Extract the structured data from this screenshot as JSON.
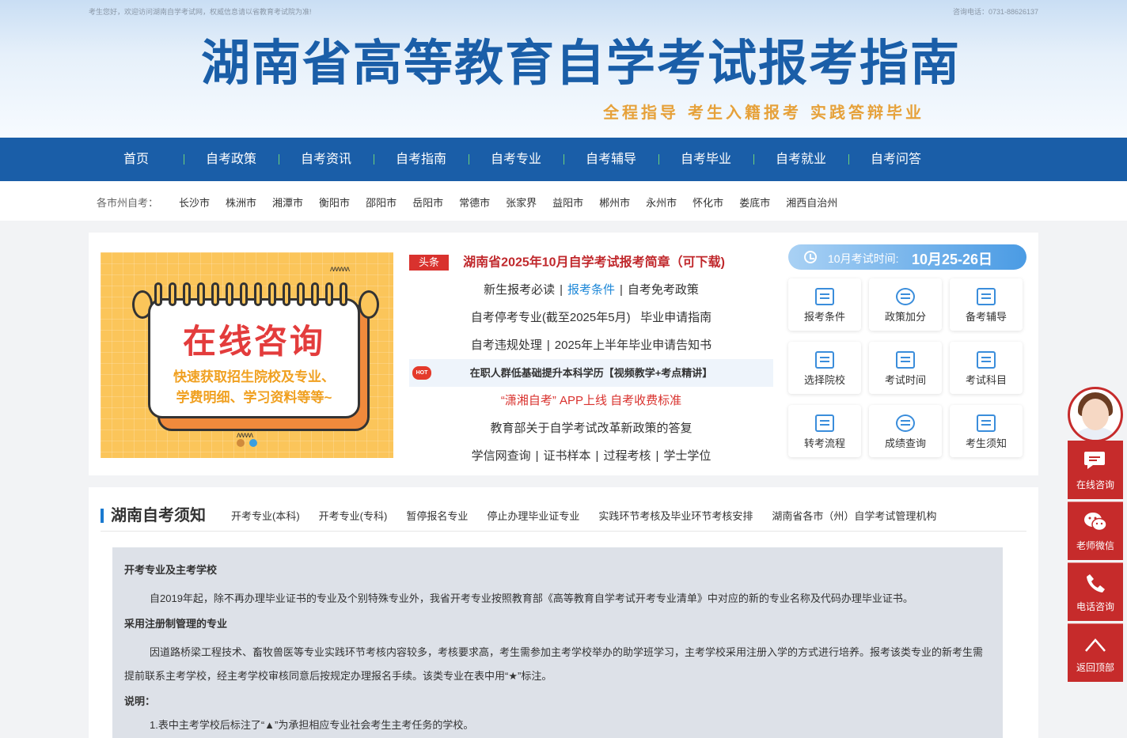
{
  "header": {
    "welcome": "考生您好，欢迎访问湖南自学考试网，权威信息请以省教育考试院为准!",
    "hotline": "咨询电话：0731-88626137",
    "title": "湖南省高等教育自学考试报考指南",
    "slogan": "全程指导 考生入籍报考 实践答辩毕业"
  },
  "nav": [
    "首页",
    "自考政策",
    "自考资讯",
    "自考指南",
    "自考专业",
    "自考辅导",
    "自考毕业",
    "自考就业",
    "自考问答"
  ],
  "citybar": {
    "label": "各市州自考：",
    "cities": [
      "长沙市",
      "株洲市",
      "湘潭市",
      "衡阳市",
      "邵阳市",
      "岳阳市",
      "常德市",
      "张家界",
      "益阳市",
      "郴州市",
      "永州市",
      "怀化市",
      "娄底市",
      "湘西自治州"
    ]
  },
  "banner": {
    "title": "在线咨询",
    "line1": "快速获取招生院校及专业、",
    "line2": "学费明细、学习资料等等~"
  },
  "news": {
    "tag": "头条",
    "headline": "湖南省2025年10月自学考试报考简章（可下载)",
    "row2": [
      "新生报考必读",
      "报考条件",
      "自考免考政策"
    ],
    "row3": [
      "自考停考专业(截至2025年5月)",
      "毕业申请指南"
    ],
    "row4": [
      "自考违规处理",
      "2025年上半年毕业申请告知书"
    ],
    "hot_badge": "HOT",
    "hot_text": "在职人群低基础提升本科学历【视频教学+考点精讲】",
    "row6": "“潇湘自考” APP上线 自考收费标准",
    "row7": "教育部关于自学考试改革新政策的答复",
    "row8": [
      "学信网查询",
      "证书样本",
      "过程考核",
      "学士学位"
    ]
  },
  "exam": {
    "label": "10月考试时间:",
    "date": "10月25-26日"
  },
  "tiles": [
    "报考条件",
    "政策加分",
    "备考辅导",
    "选择院校",
    "考试时间",
    "考试科目",
    "转考流程",
    "成绩查询",
    "考生须知"
  ],
  "notice": {
    "title": "湖南自考须知",
    "tabs": [
      "开考专业(本科)",
      "开考专业(专科)",
      "暂停报名专业",
      "停止办理毕业证专业",
      "实践环节考核及毕业环节考核安排",
      "湖南省各市（州）自学考试管理机构"
    ],
    "h1": "开考专业及主考学校",
    "p1": "自2019年起，除不再办理毕业证书的专业及个别特殊专业外，我省开考专业按照教育部《高等教育自学考试开考专业清单》中对应的新的专业名称及代码办理毕业证书。",
    "h2": "采用注册制管理的专业",
    "p2": "因道路桥梁工程技术、畜牧兽医等专业实践环节考核内容较多，考核要求高，考生需参加主考学校举办的助学班学习，主考学校采用注册入学的方式进行培养。报考该类专业的新考生需提前联系主考学校，经主考学校审核同意后按规定办理报名手续。该类专业在表中用“★”标注。",
    "h3": "说明：",
    "p3": "1.表中主考学校后标注了“▲”为承担相应专业社会考生主考任务的学校。"
  },
  "sidebar": [
    "在线咨询",
    "老师微信",
    "电话咨询",
    "返回顶部"
  ]
}
